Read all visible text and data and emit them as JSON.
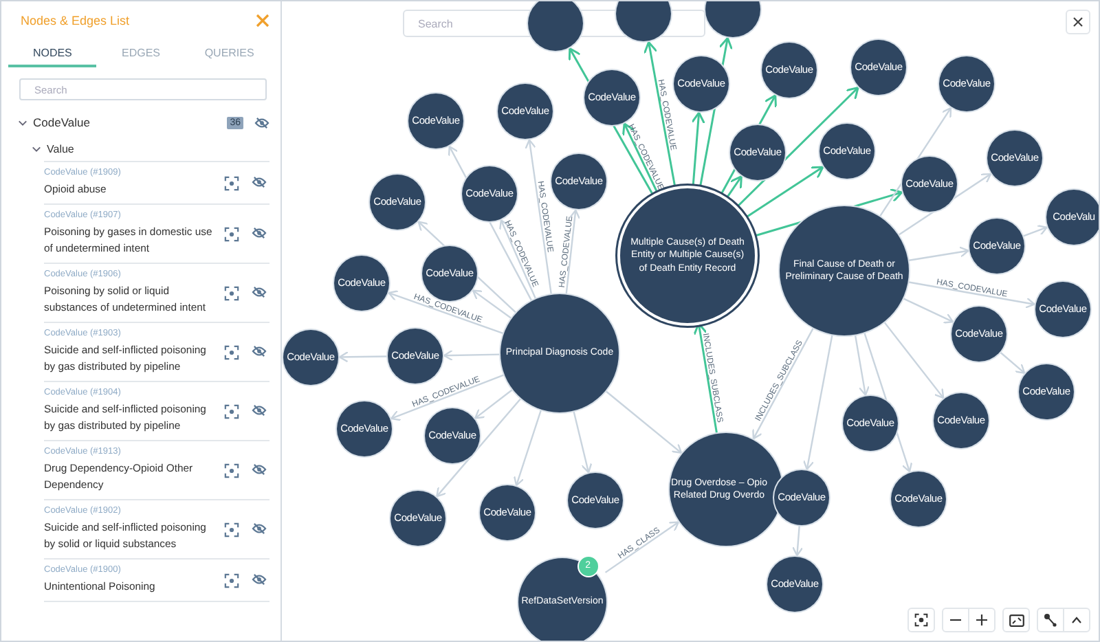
{
  "panel": {
    "title": "Nodes & Edges List",
    "tabs": [
      {
        "label": "NODES",
        "selected": true
      },
      {
        "label": "EDGES",
        "selected": false
      },
      {
        "label": "QUERIES",
        "selected": false
      }
    ],
    "search": {
      "placeholder": "Search"
    },
    "tree": [
      {
        "label": "CodeValue",
        "count": "36",
        "expanded": true,
        "children": [
          {
            "label": "Value",
            "expanded": true,
            "items": [
              {
                "type_label": "CodeValue (#1909)",
                "name": "Opioid abuse"
              },
              {
                "type_label": "CodeValue (#1907)",
                "name": "Poisoning by gases in domestic use of undetermined intent"
              },
              {
                "type_label": "CodeValue (#1906)",
                "name": "Poisoning by solid or liquid substances of undetermined intent"
              },
              {
                "type_label": "CodeValue (#1903)",
                "name": "Suicide and self-inflicted poisoning by gas distributed by pipeline"
              },
              {
                "type_label": "CodeValue (#1904)",
                "name": "Suicide and self-inflicted poisoning by gas distributed by pipeline"
              },
              {
                "type_label": "CodeValue (#1913)",
                "name": "Drug Dependency-Opioid Other Dependency"
              },
              {
                "type_label": "CodeValue (#1902)",
                "name": "Suicide and self-inflicted poisoning by solid or liquid substances"
              },
              {
                "type_label": "CodeValue (#1900)",
                "name": "Unintentional Poisoning"
              }
            ]
          }
        ]
      }
    ]
  },
  "graph": {
    "search": {
      "placeholder": "Search"
    },
    "nodes": [
      {
        "kind": "hub",
        "label": "Multiple Cause(s) of Death\nEntity or Multiple Cause(s)\nof Death Entity Record",
        "selected": true
      },
      {
        "kind": "hub",
        "label": "Final Cause of Death or\nPreliminary Cause of Death",
        "selected": false
      },
      {
        "kind": "hub",
        "label": "Principal Diagnosis Code",
        "selected": false
      },
      {
        "kind": "hub",
        "label": "Drug Overdose – Opio\nRelated Drug Overdo",
        "selected": false
      },
      {
        "kind": "class",
        "label": "RefDataSetVersion",
        "selected": false,
        "badge": "2"
      },
      {
        "kind": "leaf",
        "selected": false
      },
      {
        "kind": "leaf",
        "selected": false
      },
      {
        "kind": "leaf",
        "selected": false
      },
      {
        "kind": "leaf",
        "label": "CodeValue",
        "selected": false
      },
      {
        "kind": "leaf",
        "label": "CodeValue",
        "selected": false
      },
      {
        "kind": "leaf",
        "label": "CodeValue",
        "selected": false
      },
      {
        "kind": "leaf",
        "label": "CodeValue",
        "selected": false
      },
      {
        "kind": "leaf",
        "label": "CodeValue",
        "selected": false
      },
      {
        "kind": "leaf",
        "label": "CodeValue",
        "selected": false
      },
      {
        "kind": "leaf",
        "label": "CodeValue",
        "selected": false
      },
      {
        "kind": "leaf",
        "label": "CodeValue",
        "selected": false
      },
      {
        "kind": "leaf",
        "label": "CodeValue",
        "selected": false
      },
      {
        "kind": "leaf",
        "label": "CodeValue",
        "selected": false
      },
      {
        "kind": "leaf",
        "label": "CodeValu",
        "selected": false
      },
      {
        "kind": "leaf",
        "label": "CodeValue",
        "selected": false
      },
      {
        "kind": "leaf",
        "label": "CodeValue",
        "selected": false
      },
      {
        "kind": "leaf",
        "label": "CodeValue",
        "selected": false
      },
      {
        "kind": "leaf",
        "label": "CodeValue",
        "selected": false
      },
      {
        "kind": "leaf",
        "label": "CodeValue",
        "selected": false
      },
      {
        "kind": "leaf",
        "label": "CodeValue",
        "selected": false
      },
      {
        "kind": "leaf",
        "label": "CodeValue",
        "selected": false
      },
      {
        "kind": "leaf",
        "label": "CodeValue",
        "selected": false
      },
      {
        "kind": "leaf",
        "label": "CodeValue",
        "selected": false
      },
      {
        "kind": "leaf",
        "label": "CodeValue",
        "selected": false
      },
      {
        "kind": "leaf",
        "label": "CodeValue",
        "selected": false
      },
      {
        "kind": "leaf",
        "label": "CodeValue",
        "selected": false
      },
      {
        "kind": "leaf",
        "label": "CodeValue",
        "selected": false
      },
      {
        "kind": "leaf",
        "label": "CodeValue",
        "selected": false
      },
      {
        "kind": "leaf",
        "label": "CodeValue",
        "selected": false
      },
      {
        "kind": "leaf",
        "label": "CodeValue",
        "selected": false
      },
      {
        "kind": "leaf",
        "label": "CodeValue",
        "selected": false
      },
      {
        "kind": "leaf",
        "label": "CodeValue",
        "selected": false
      },
      {
        "kind": "leaf",
        "label": "CodeValue",
        "selected": false
      },
      {
        "kind": "leaf",
        "label": "CodeValue",
        "selected": false
      },
      {
        "kind": "leaf",
        "label": "CodeValue",
        "selected": false
      },
      {
        "kind": "leaf",
        "label": "CodeValue",
        "selected": false
      }
    ],
    "edges": [
      {
        "highlighted": true
      },
      {
        "label": "HAS_CODEVALUE",
        "highlighted": true
      },
      {
        "highlighted": true
      },
      {
        "label": "HAS_CODEVALUE",
        "highlighted": true
      },
      {
        "highlighted": true
      },
      {
        "highlighted": true
      },
      {
        "highlighted": true
      },
      {
        "highlighted": true
      },
      {
        "highlighted": true
      },
      {
        "highlighted": true
      },
      {
        "label": "INCLUDES_SUBCLASS",
        "highlighted": true
      },
      {
        "highlighted": false
      },
      {
        "highlighted": false
      },
      {
        "highlighted": false
      },
      {
        "highlighted": false
      },
      {
        "label": "HAS_CODEVALUE",
        "highlighted": false
      },
      {
        "highlighted": false
      },
      {
        "highlighted": false
      },
      {
        "highlighted": false
      },
      {
        "highlighted": false
      },
      {
        "highlighted": false
      },
      {
        "highlighted": false
      },
      {
        "highlighted": false
      },
      {
        "label": "INCLUDES_SUBCLASS",
        "highlighted": false
      },
      {
        "highlighted": false
      },
      {
        "label": "HAS_CODEVALUE",
        "highlighted": false
      },
      {
        "label": "HAS_CODEVALUE",
        "highlighted": false
      },
      {
        "highlighted": false
      },
      {
        "label": "HAS_CODEVALUE",
        "highlighted": false
      },
      {
        "highlighted": false
      },
      {
        "label": "HAS_CODEVALUE",
        "highlighted": false
      },
      {
        "highlighted": false
      },
      {
        "highlighted": false
      },
      {
        "label": "HAS_CODEVALUE",
        "highlighted": false
      },
      {
        "highlighted": false
      },
      {
        "highlighted": false
      },
      {
        "highlighted": false
      },
      {
        "highlighted": false
      },
      {
        "highlighted": false
      },
      {
        "label": "HAS_CLASS",
        "highlighted": false
      }
    ]
  }
}
